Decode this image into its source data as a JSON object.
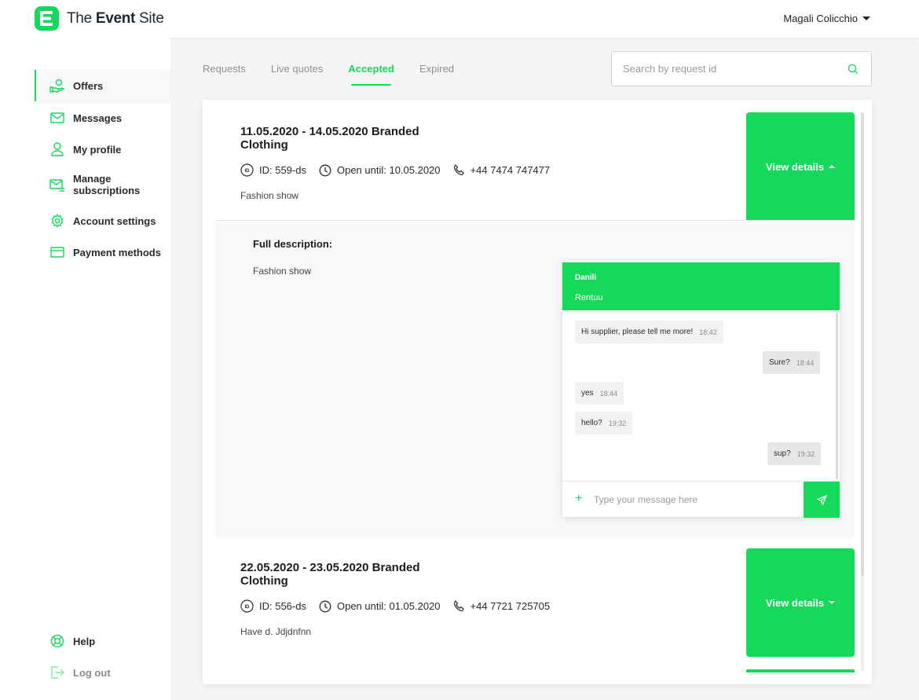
{
  "header": {
    "brand_prefix": "The ",
    "brand_bold": "Event",
    "brand_suffix": " Site",
    "user_name": "Magali Colicchio"
  },
  "sidebar": {
    "items": [
      {
        "label": "Offers",
        "icon": "hand-money-icon",
        "active": true
      },
      {
        "label": "Messages",
        "icon": "envelope-icon"
      },
      {
        "label": "My profile",
        "icon": "user-icon"
      },
      {
        "label": "Manage",
        "label2": "subscriptions",
        "icon": "mail-list-icon"
      },
      {
        "label": "Account settings",
        "icon": "gear-icon"
      },
      {
        "label": "Payment methods",
        "icon": "credit-card-icon"
      }
    ],
    "bottom": [
      {
        "label": "Help",
        "icon": "lifebuoy-icon"
      },
      {
        "label": "Log out",
        "icon": "logout-icon"
      }
    ]
  },
  "tabs": [
    {
      "label": "Requests"
    },
    {
      "label": "Live quotes"
    },
    {
      "label": "Accepted",
      "active": true
    },
    {
      "label": "Expired"
    }
  ],
  "search": {
    "placeholder": "Search by request id"
  },
  "offers": [
    {
      "title": "11.05.2020 - 14.05.2020 Branded Clothing",
      "id": "ID: 559-ds",
      "open_until": "Open until: 10.05.2020",
      "phone": "+44 7474 747477",
      "description": "Fashion show",
      "button": "View details",
      "expanded": true,
      "full_description_label": "Full description:",
      "full_description": "Fashion show"
    },
    {
      "title": "22.05.2020 - 23.05.2020 Branded Clothing",
      "id": "ID: 556-ds",
      "open_until": "Open until: 01.05.2020",
      "phone": "+44 7721 725705",
      "description": "Have d. Jdjdnfnn",
      "button": "View details",
      "expanded": false
    }
  ],
  "chat": {
    "name": "Danili",
    "company": "Rentuu",
    "messages": [
      {
        "text": "Hi supplier, please tell me more!",
        "time": "18:42",
        "dir": "in"
      },
      {
        "text": "Sure?",
        "time": "18:44",
        "dir": "out"
      },
      {
        "text": "yes",
        "time": "18:44",
        "dir": "in"
      },
      {
        "text": "hello?",
        "time": "19:32",
        "dir": "in"
      },
      {
        "text": "sup?",
        "time": "19:32",
        "dir": "out"
      }
    ],
    "input_placeholder": "Type your message here"
  },
  "colors": {
    "accent": "#14d95a"
  }
}
